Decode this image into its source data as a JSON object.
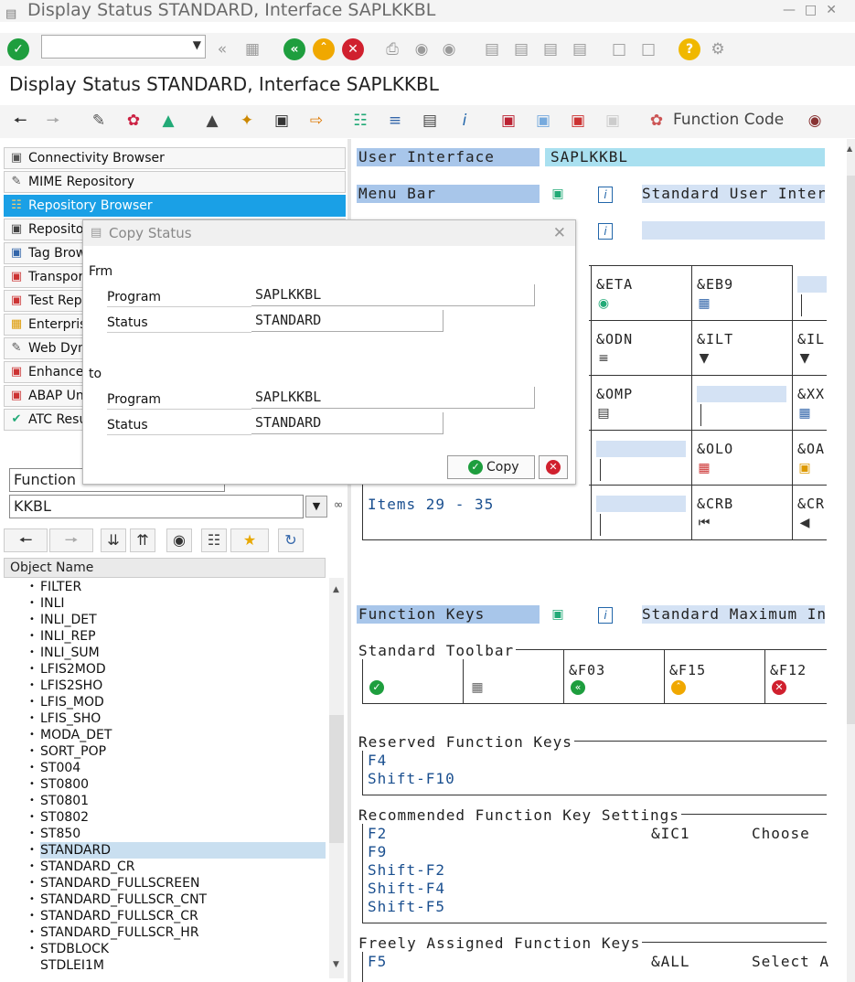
{
  "window": {
    "title": "Display Status STANDARD, Interface SAPLKKBL"
  },
  "screen_title": "Display Status STANDARD, Interface SAPLKKBL",
  "toolbar": {
    "command_field_value": ""
  },
  "app_toolbar": {
    "function_code_label": "Function Code"
  },
  "nav": {
    "items": [
      {
        "label": "Connectivity Browser"
      },
      {
        "label": "MIME Repository"
      },
      {
        "label": "Repository Browser"
      },
      {
        "label": "Repositor"
      },
      {
        "label": "Tag Brow"
      },
      {
        "label": "Transpor"
      },
      {
        "label": "Test Rep"
      },
      {
        "label": "Enterprise"
      },
      {
        "label": "Web Dyn"
      },
      {
        "label": "Enhancer"
      },
      {
        "label": "ABAP Uni"
      },
      {
        "label": "ATC Resu"
      }
    ],
    "function_type": "Function",
    "object_value": "KKBL"
  },
  "tree": {
    "header": "Object Name",
    "items": [
      "FILTER",
      "INLI",
      "INLI_DET",
      "INLI_REP",
      "INLI_SUM",
      "LFIS2MOD",
      "LFIS2SHO",
      "LFIS_MOD",
      "LFIS_SHO",
      "MODA_DET",
      "SORT_POP",
      "ST004",
      "ST0800",
      "ST0801",
      "ST0802",
      "ST850",
      "STANDARD",
      "STANDARD_CR",
      "STANDARD_FULLSCREEN",
      "STANDARD_FULLSCR_CNT",
      "STANDARD_FULLSCR_CR",
      "STANDARD_FULLSCR_HR",
      "STDBLOCK",
      "STDLEI1M"
    ],
    "selected": "STANDARD"
  },
  "right": {
    "user_interface_label": "User Interface",
    "user_interface_value": "SAPLKKBL",
    "menu_bar_label": "Menu Bar",
    "menu_bar_desc": "Standard User Interf",
    "grid_codes": {
      "r1c2": "&ETA",
      "r1c3": "&EB9",
      "r2c2": "&ODN",
      "r2c3": "&ILT",
      "r2c4": "&IL",
      "r3c2": "&OMP",
      "r3c4": "&XX",
      "r4c3": "&OLO",
      "r4c4": "&OA",
      "r5c3": "&CRB",
      "r5c4": "&CR"
    },
    "items_label": "Items 29 - 35",
    "function_keys_label": "Function Keys",
    "function_keys_desc": "Standard Maximum Int",
    "standard_toolbar_label": "Standard Toolbar",
    "toolbar_codes": {
      "c3": "&F03",
      "c4": "&F15",
      "c5": "&F12"
    },
    "reserved_label": "Reserved Function Keys",
    "reserved_keys": [
      "F4",
      "Shift-F10"
    ],
    "recommended_label": "Recommended Function Key Settings",
    "recommended_keys": [
      "F2",
      "F9",
      "Shift-F2",
      "Shift-F4",
      "Shift-F5"
    ],
    "recommended_f2_code": "&IC1",
    "recommended_f2_text": "Choose",
    "freely_label": "Freely Assigned Function Keys",
    "freely_key": "F5",
    "freely_code": "&ALL",
    "freely_text": "Select A"
  },
  "dialog": {
    "title": "Copy Status",
    "from_label": "Frm",
    "to_label": "to",
    "program_label": "Program",
    "status_label": "Status",
    "from_program": "SAPLKKBL",
    "from_status": "STANDARD",
    "to_program": "SAPLKKBL",
    "to_status": "STANDARD",
    "copy_button": "Copy"
  },
  "colors": {
    "selected_nav": "#1aa0e6",
    "label_bg": "#a8c6ea",
    "value_bg": "#a9e0f0",
    "green": "#1e9e3e",
    "red": "#d0202e",
    "orange": "#f0a800"
  }
}
